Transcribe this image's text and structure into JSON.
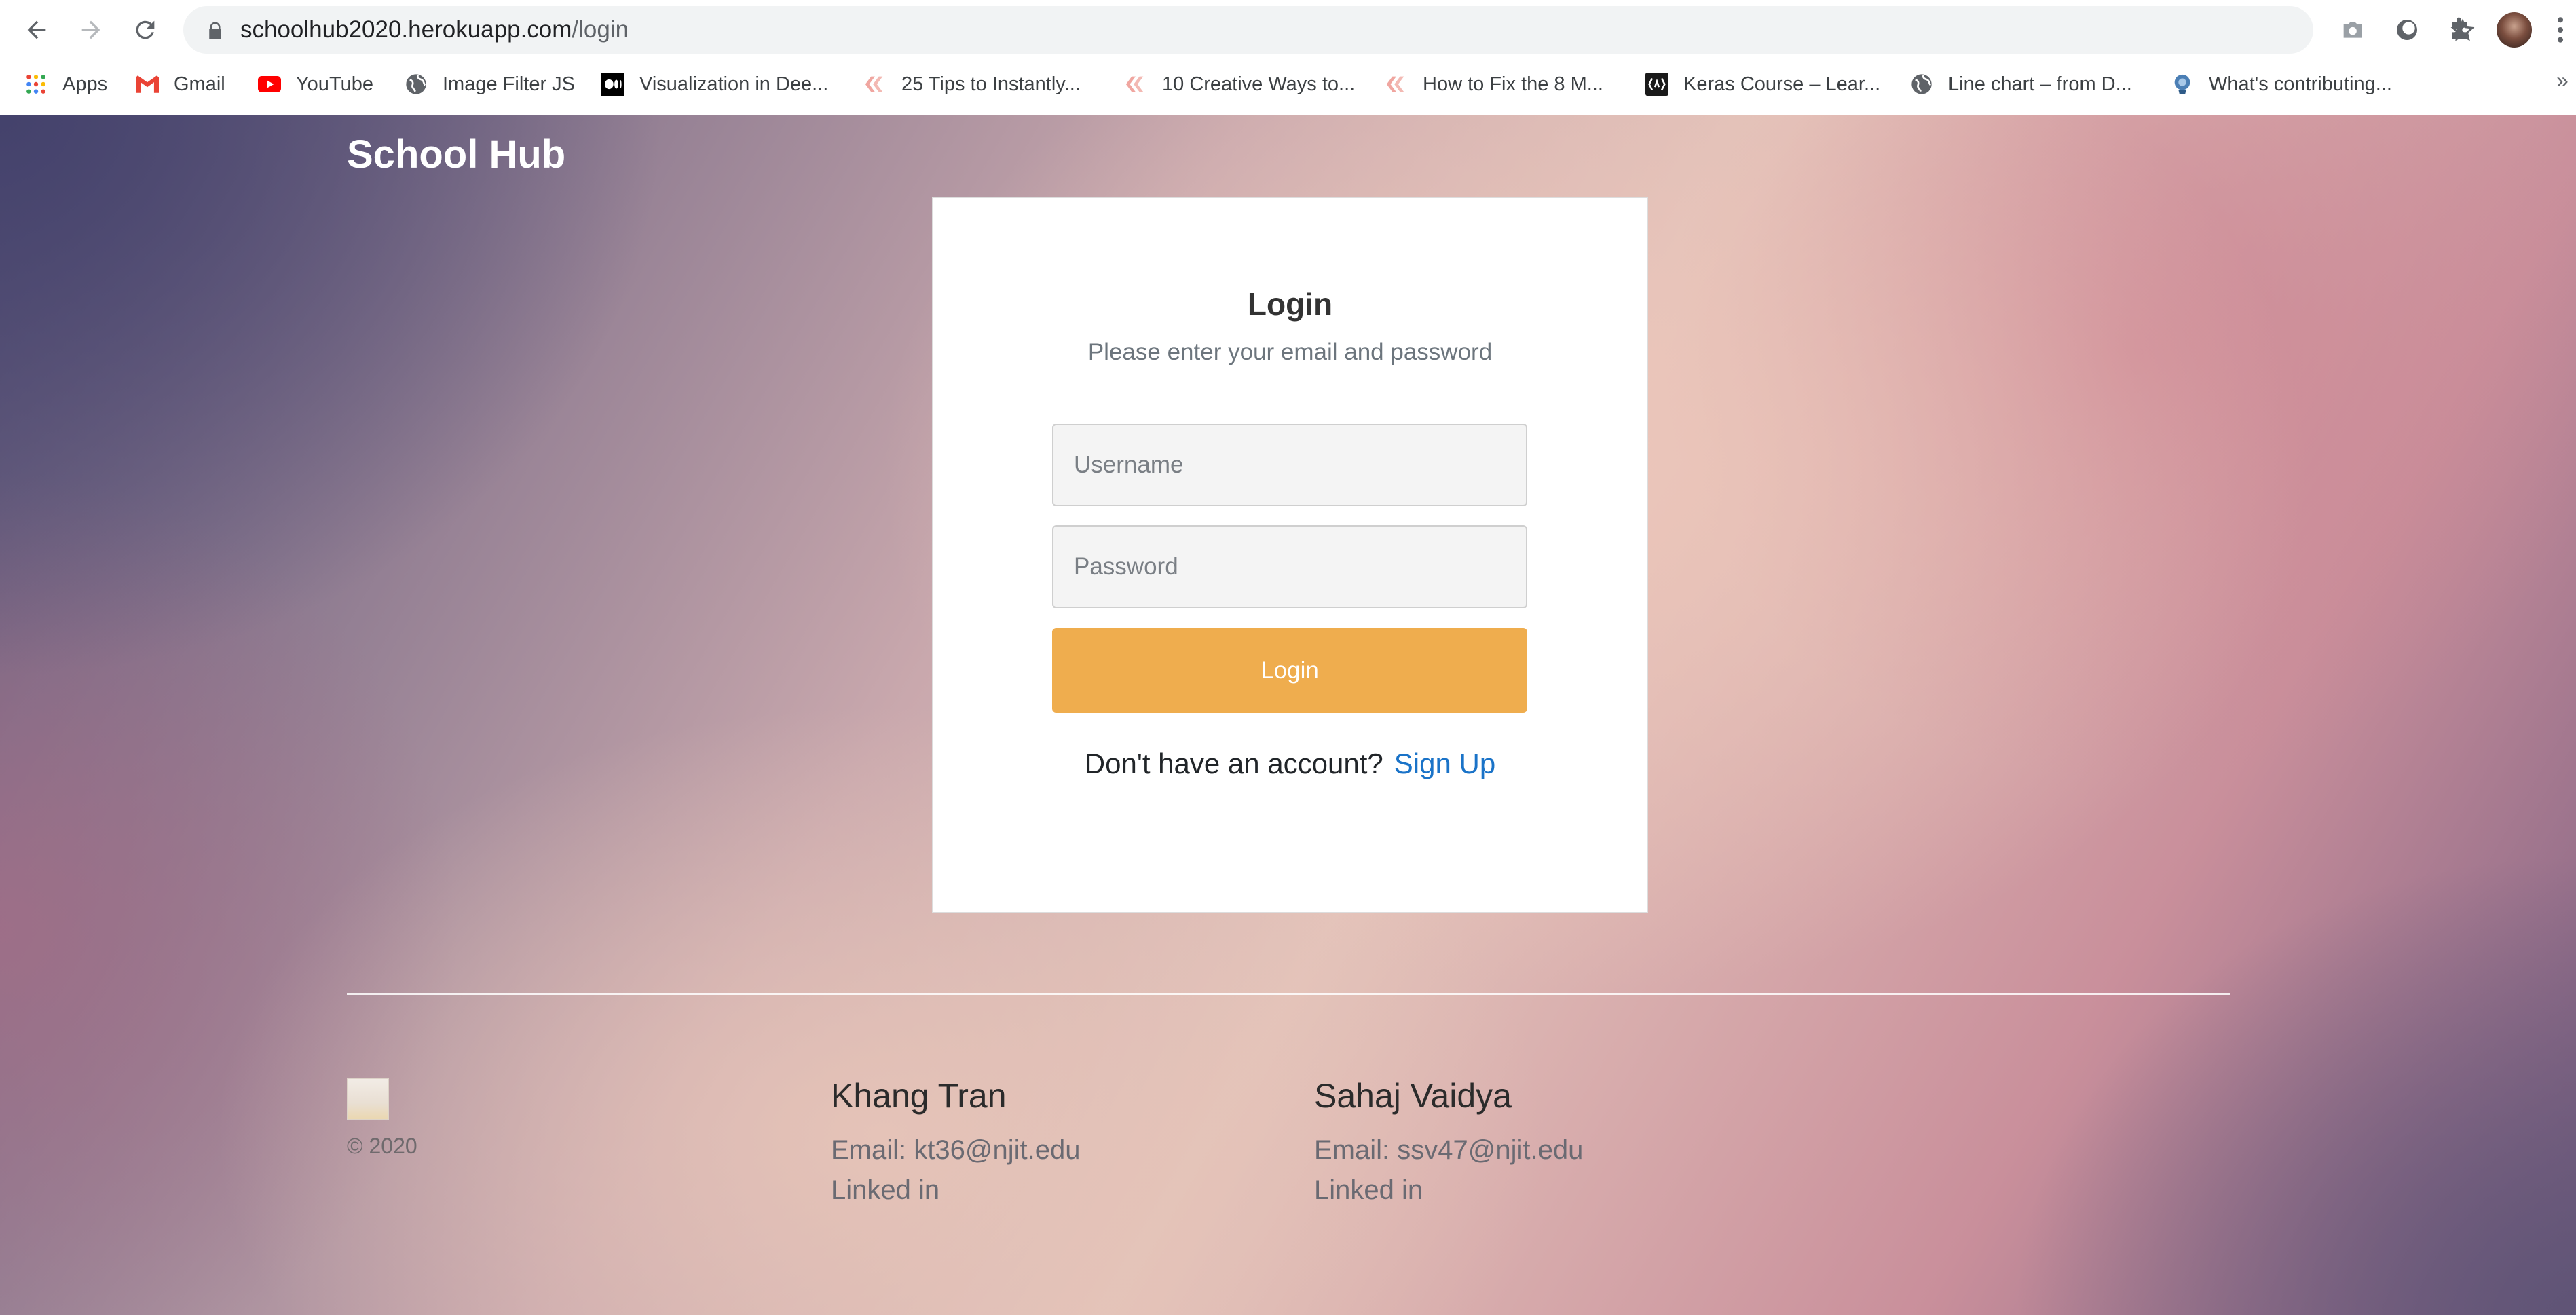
{
  "browser": {
    "url_host": "schoolhub2020.herokuapp.com",
    "url_path": "/login",
    "more_label": "»",
    "bookmarks": [
      {
        "label": "Apps",
        "icon": "apps-grid-icon"
      },
      {
        "label": "Gmail",
        "icon": "gmail-icon"
      },
      {
        "label": "YouTube",
        "icon": "youtube-icon"
      },
      {
        "label": "Image Filter JS",
        "icon": "globe-icon"
      },
      {
        "label": "Visualization in Dee...",
        "icon": "medium-icon"
      },
      {
        "label": "25 Tips to Instantly...",
        "icon": "hubspot-icon"
      },
      {
        "label": "10 Creative Ways to...",
        "icon": "hubspot-icon"
      },
      {
        "label": "How to Fix the 8 M...",
        "icon": "hubspot-icon"
      },
      {
        "label": "Keras Course – Lear...",
        "icon": "keras-icon"
      },
      {
        "label": "Line chart – from D...",
        "icon": "globe-icon"
      },
      {
        "label": "What's contributing...",
        "icon": "site-icon"
      }
    ]
  },
  "site": {
    "brand": "School Hub"
  },
  "login": {
    "title": "Login",
    "subtitle": "Please enter your email and password",
    "username_placeholder": "Username",
    "password_placeholder": "Password",
    "button_label": "Login",
    "no_account_text": "Don't have an account?",
    "signup_link": "Sign Up"
  },
  "footer": {
    "copyright": "© 2020",
    "authors": [
      {
        "name": "Khang Tran",
        "email": "Email: kt36@njit.edu",
        "linkedin": "Linked in"
      },
      {
        "name": "Sahaj Vaidya",
        "email": "Email: ssv47@njit.edu",
        "linkedin": "Linked in"
      }
    ]
  },
  "colors": {
    "login_button": "#efad4e",
    "link": "#1a73c8"
  }
}
